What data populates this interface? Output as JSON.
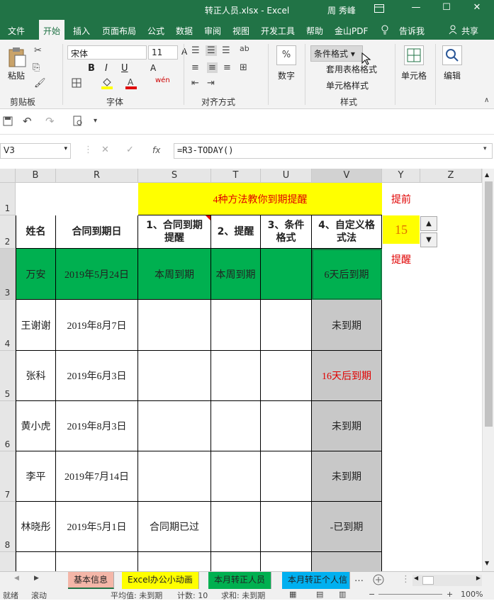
{
  "titlebar": {
    "title": "转正人员.xlsx  -  Excel",
    "user": "周 秀峰",
    "restore_icon": "ribbon-display-icon",
    "minimize": "—",
    "maximize": "☐",
    "close": "✕"
  },
  "tabs": [
    "文件",
    "开始",
    "插入",
    "页面布局",
    "公式",
    "数据",
    "审阅",
    "视图",
    "开发工具",
    "帮助",
    "金山PDF",
    "告诉我",
    "共享"
  ],
  "ribbon": {
    "clipboard": {
      "paste": "粘贴",
      "label": "剪贴板"
    },
    "font": {
      "name": "宋体",
      "size": "11",
      "label": "字体",
      "bold": "B",
      "italic": "I",
      "underline": "U",
      "wen": "wén"
    },
    "align": {
      "label": "对齐方式"
    },
    "number": {
      "label": "数字"
    },
    "styles": {
      "conditional": "条件格式",
      "table": "套用表格格式",
      "cell": "单元格样式",
      "label": "样式"
    },
    "cells": {
      "label": "单元格"
    },
    "editing": {
      "label": "编辑"
    }
  },
  "formula": {
    "namebox": "V3",
    "fx": "fx",
    "content": "=R3-TODAY()"
  },
  "columns": [
    "B",
    "R",
    "S",
    "T",
    "U",
    "V",
    "Y",
    "Z"
  ],
  "rows": [
    "1",
    "2",
    "3",
    "4",
    "5",
    "6",
    "7",
    "8"
  ],
  "sheet": {
    "banner": "4种方法教你到期提醒",
    "ahead_label": "提前",
    "spinner_value": "15",
    "remind_label": "提醒",
    "headers": [
      "姓名",
      "合同到期日",
      "1、合同到期提醒",
      "2、提醒",
      "3、条件格式",
      "4、自定义格式法"
    ],
    "records": [
      {
        "name": "万安",
        "date": "2019年5月24日",
        "s": "本周到期",
        "t": "本周到期",
        "u": "",
        "v": "6天后到期"
      },
      {
        "name": "王谢谢",
        "date": "2019年8月7日",
        "s": "",
        "t": "",
        "u": "",
        "v": "未到期"
      },
      {
        "name": "张科",
        "date": "2019年6月3日",
        "s": "",
        "t": "",
        "u": "",
        "v": "16天后到期"
      },
      {
        "name": "黄小虎",
        "date": "2019年8月3日",
        "s": "",
        "t": "",
        "u": "",
        "v": "未到期"
      },
      {
        "name": "李平",
        "date": "2019年7月14日",
        "s": "",
        "t": "",
        "u": "",
        "v": "未到期"
      },
      {
        "name": "林晓彤",
        "date": "2019年5月1日",
        "s": "合同期已过",
        "t": "",
        "u": "",
        "v": "-已到期"
      }
    ]
  },
  "sheet_tabs": [
    "基本信息",
    "Excel办公小动画",
    "本月转正人员",
    "本月转正个人信"
  ],
  "status": {
    "ready": "就绪",
    "scroll": "滚动",
    "average": "平均值: 未到期",
    "count": "计数: 10",
    "sum": "求和: 未到期",
    "zoom": "100%"
  },
  "colors": {
    "excel_green": "#217346",
    "yellow": "#ffff00",
    "green_fill": "#00b050",
    "gray_fill": "#c8c8c8",
    "red_text": "#e00000"
  }
}
